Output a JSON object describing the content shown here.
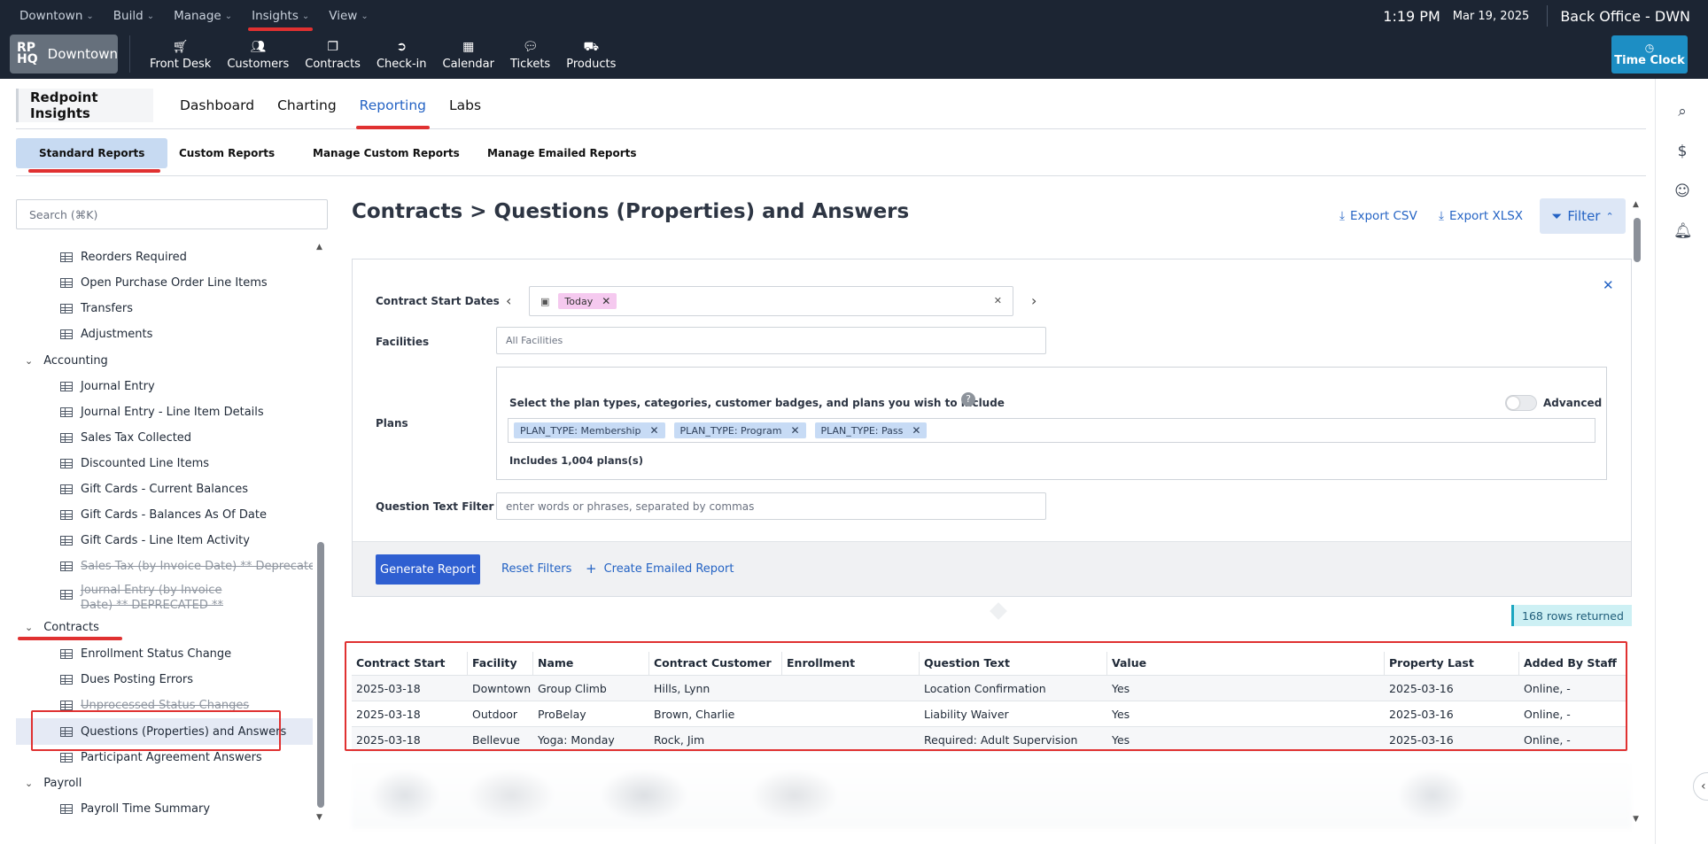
{
  "menubar": {
    "items": [
      "Downtown",
      "Build",
      "Manage",
      "Insights",
      "View"
    ],
    "time": "1:19 PM",
    "date": "Mar 19, 2025",
    "office": "Back Office - DWN"
  },
  "toolbar": {
    "brand_logo": "RP HQ",
    "brand_name": "Downtown",
    "tools": [
      {
        "label": "Front Desk",
        "icon": "cart-icon"
      },
      {
        "label": "Customers",
        "icon": "users-icon"
      },
      {
        "label": "Contracts",
        "icon": "contracts-icon"
      },
      {
        "label": "Check-in",
        "icon": "checkin-icon"
      },
      {
        "label": "Calendar",
        "icon": "calendar-icon"
      },
      {
        "label": "Tickets",
        "icon": "chat-icon"
      },
      {
        "label": "Products",
        "icon": "products-icon"
      }
    ],
    "timeclock": "Time Clock"
  },
  "insights": {
    "brand": "Redpoint Insights",
    "tabs": [
      "Dashboard",
      "Charting",
      "Reporting",
      "Labs"
    ],
    "active_tab": "Reporting",
    "subtabs": [
      "Standard Reports",
      "Custom Reports",
      "Manage Custom Reports",
      "Manage Emailed Reports"
    ]
  },
  "sidebar": {
    "search_placeholder": "Search (⌘K)",
    "inventory_items": [
      "Reorders Required",
      "Open Purchase Order Line Items",
      "Transfers",
      "Adjustments"
    ],
    "accounting_label": "Accounting",
    "accounting_items": [
      "Journal Entry",
      "Journal Entry - Line Item Details",
      "Sales Tax Collected",
      "Discounted Line Items",
      "Gift Cards - Current Balances",
      "Gift Cards - Balances As Of Date",
      "Gift Cards - Line Item Activity"
    ],
    "deprecated_1": "Sales Tax (by Invoice Date) ** Deprecated **",
    "deprecated_2": "Journal Entry (by Invoice Date) ** DEPRECATED **",
    "contracts_label": "Contracts",
    "contracts_items": [
      "Enrollment Status Change",
      "Dues Posting Errors",
      "Unprocessed Status Changes",
      "Questions (Properties) and Answers",
      "Participant Agreement Answers"
    ],
    "payroll_label": "Payroll",
    "payroll_items": [
      "Payroll Time Summary"
    ]
  },
  "main": {
    "title": "Contracts > Questions (Properties) and Answers",
    "export_csv": "Export CSV",
    "export_xlsx": "Export XLSX",
    "filter": "Filter"
  },
  "filters": {
    "start_dates_label": "Contract Start Dates",
    "start_dates_chip": "Today",
    "facilities_label": "Facilities",
    "facilities_placeholder": "All Facilities",
    "plans_label": "Plans",
    "plans_prompt": "Select the plan types, categories, customer badges, and plans you wish to include",
    "advanced_label": "Advanced",
    "plan_chips": [
      "PLAN_TYPE: Membership",
      "PLAN_TYPE: Program",
      "PLAN_TYPE: Pass"
    ],
    "includes_text": "Includes 1,004 plans(s)",
    "question_label": "Question Text Filter",
    "question_placeholder": "enter words or phrases, separated by commas",
    "generate": "Generate Report",
    "reset": "Reset Filters",
    "emailed": "Create Emailed Report"
  },
  "results": {
    "rows_returned": "168 rows returned",
    "columns": [
      "Contract Start Date",
      "Facility",
      "Name",
      "Contract Customer",
      "Enrollment Customer",
      "Question Text",
      "Value",
      "Property Last Updated",
      "Added By Staff"
    ],
    "rows": [
      [
        "2025-03-18",
        "Downtown",
        "Group Climb",
        "Hills, Lynn",
        "",
        "Location Confirmation",
        "Yes",
        "2025-03-16",
        "Online, -"
      ],
      [
        "2025-03-18",
        "Outdoor",
        "ProBelay",
        "Brown, Charlie",
        "",
        "Liability Waiver",
        "Yes",
        "2025-03-16",
        "Online, -"
      ],
      [
        "2025-03-18",
        "Bellevue",
        "Yoga: Monday",
        "Rock, Jim",
        "",
        "Required: Adult Supervision",
        "Yes",
        "2025-03-16",
        "Online, -"
      ]
    ]
  },
  "colors": {
    "header_bg": "#1c2533",
    "accent": "#2463c4",
    "highlight_red": "#e03131",
    "primary_button": "#2f5fd1"
  }
}
